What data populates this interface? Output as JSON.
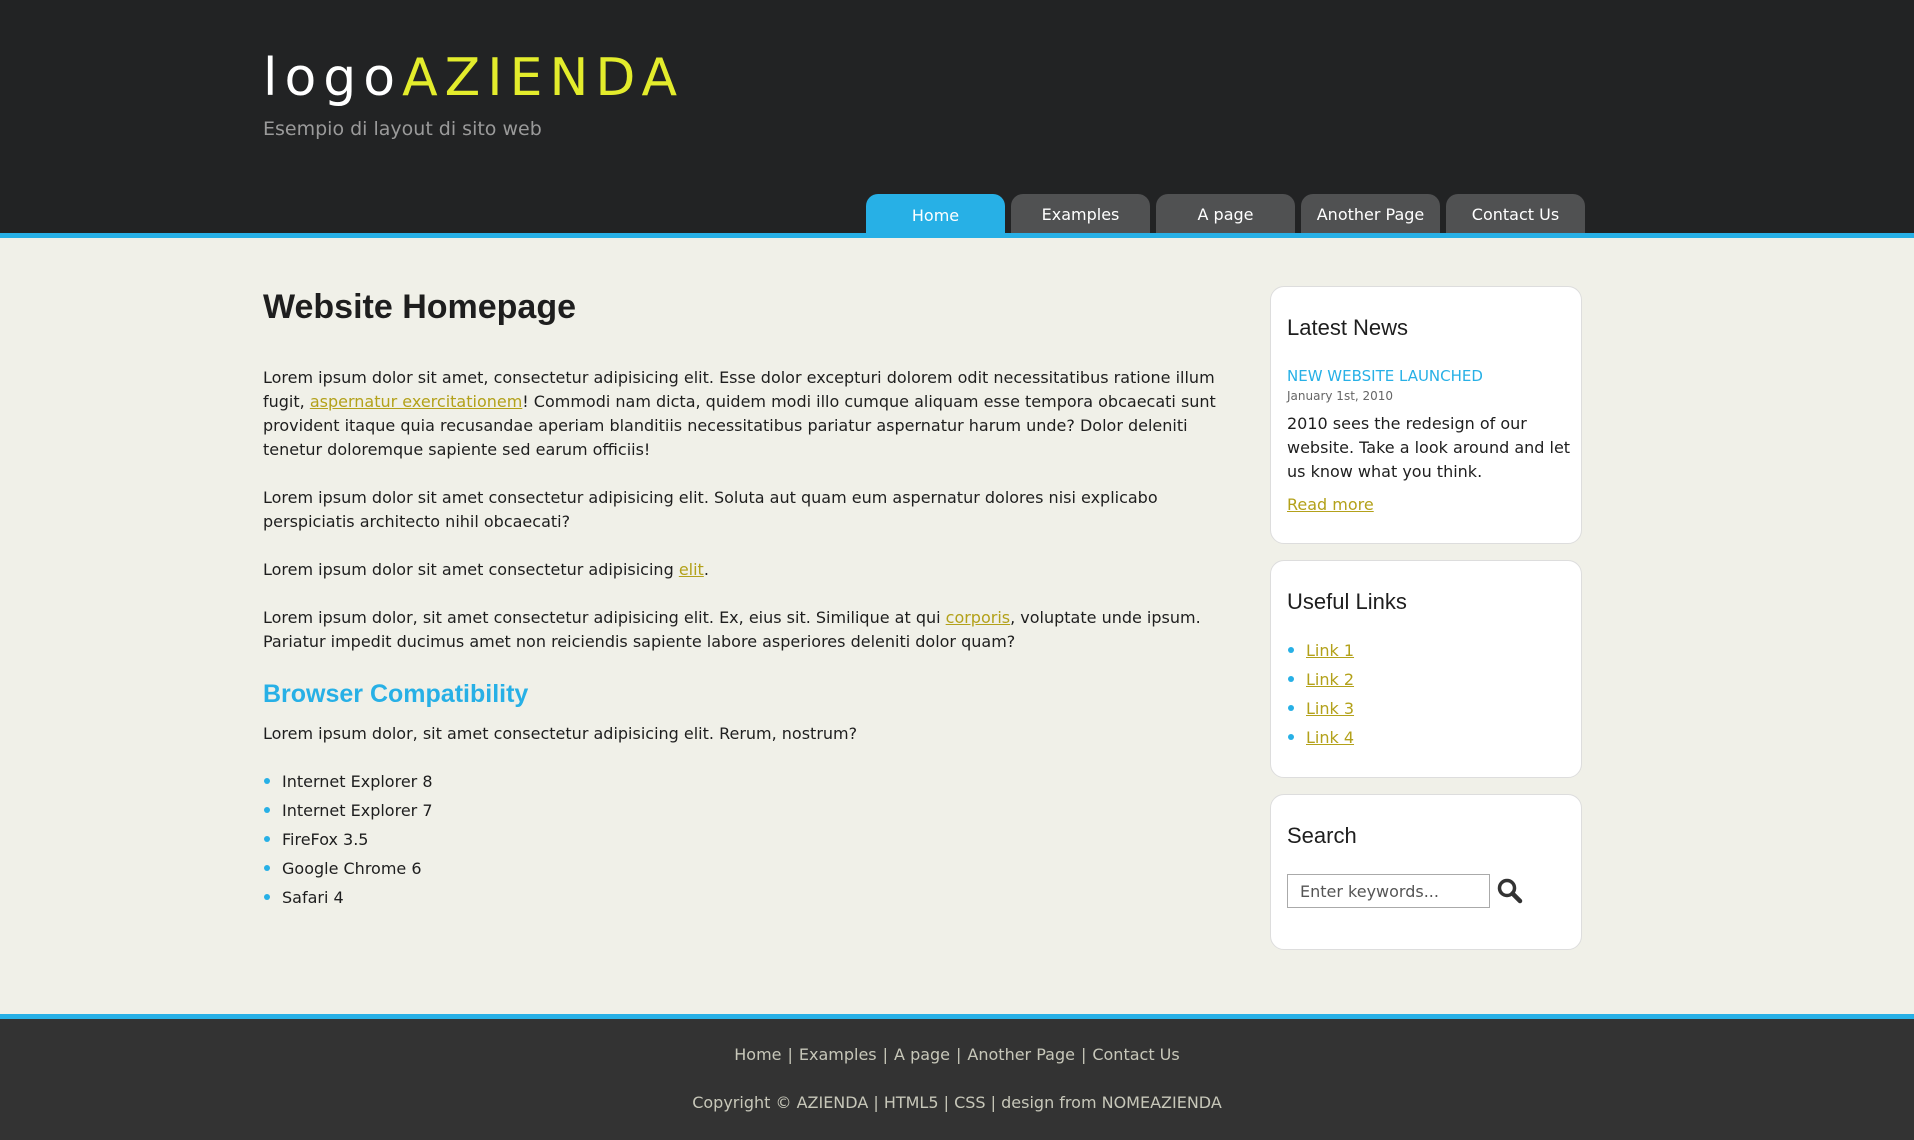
{
  "header": {
    "logo_prefix": "logo",
    "logo_accent": "AZIENDA",
    "tagline": "Esempio di layout di sito web"
  },
  "nav": {
    "tabs": [
      {
        "label": "Home",
        "active": true
      },
      {
        "label": "Examples"
      },
      {
        "label": "A page"
      },
      {
        "label": "Another Page"
      },
      {
        "label": "Contact Us"
      }
    ]
  },
  "main": {
    "title": "Website Homepage",
    "p1_a": "Lorem ipsum dolor sit amet, consectetur adipisicing elit. Esse dolor excepturi dolorem odit necessitatibus ratione illum fugit, ",
    "p1_link": "aspernatur exercitationem",
    "p1_b": "! Commodi nam dicta, quidem modi illo cumque aliquam esse tempora obcaecati sunt provident itaque quia recusandae aperiam blanditiis necessitatibus pariatur aspernatur harum unde? Dolor deleniti tenetur doloremque sapiente sed earum officiis!",
    "p2": "Lorem ipsum dolor sit amet consectetur adipisicing elit. Soluta aut quam eum aspernatur dolores nisi explicabo perspiciatis architecto nihil obcaecati?",
    "p3_a": "Lorem ipsum dolor sit amet consectetur adipisicing ",
    "p3_link": "elit",
    "p3_b": ".",
    "p4_a": "Lorem ipsum dolor, sit amet consectetur adipisicing elit. Ex, eius sit. Similique at qui ",
    "p4_link": "corporis",
    "p4_b": ", voluptate unde ipsum. Pariatur impedit ducimus amet non reiciendis sapiente labore asperiores deleniti dolor quam?",
    "subtitle": "Browser Compatibility",
    "p5": "Lorem ipsum dolor, sit amet consectetur adipisicing elit. Rerum, nostrum?",
    "browsers": [
      "Internet Explorer 8",
      "Internet Explorer 7",
      "FireFox 3.5",
      "Google Chrome 6",
      "Safari 4"
    ]
  },
  "sidebar": {
    "news": {
      "title": "Latest News",
      "headline": "NEW WEBSITE LAUNCHED",
      "date": "January 1st, 2010",
      "text": "2010 sees the redesign of our website. Take a look around and let us know what you think.",
      "read_more": "Read more"
    },
    "links": {
      "title": "Useful Links",
      "items": [
        "Link 1",
        "Link 2",
        "Link 3",
        "Link 4"
      ]
    },
    "search": {
      "title": "Search",
      "placeholder": "Enter keywords...",
      "icon": "search-icon"
    }
  },
  "footer": {
    "nav": [
      "Home",
      "Examples",
      "A page",
      "Another Page",
      "Contact Us"
    ],
    "copyright": "Copyright © AZIENDA | HTML5 | CSS | design from NOMEAZIENDA"
  },
  "colors": {
    "accent": "#27b0e6",
    "logo_accent": "#e3ec2c",
    "link": "#b3a11a",
    "header_bg": "#222324",
    "footer_bg": "#333333",
    "page_bg": "#f0f0e8"
  }
}
